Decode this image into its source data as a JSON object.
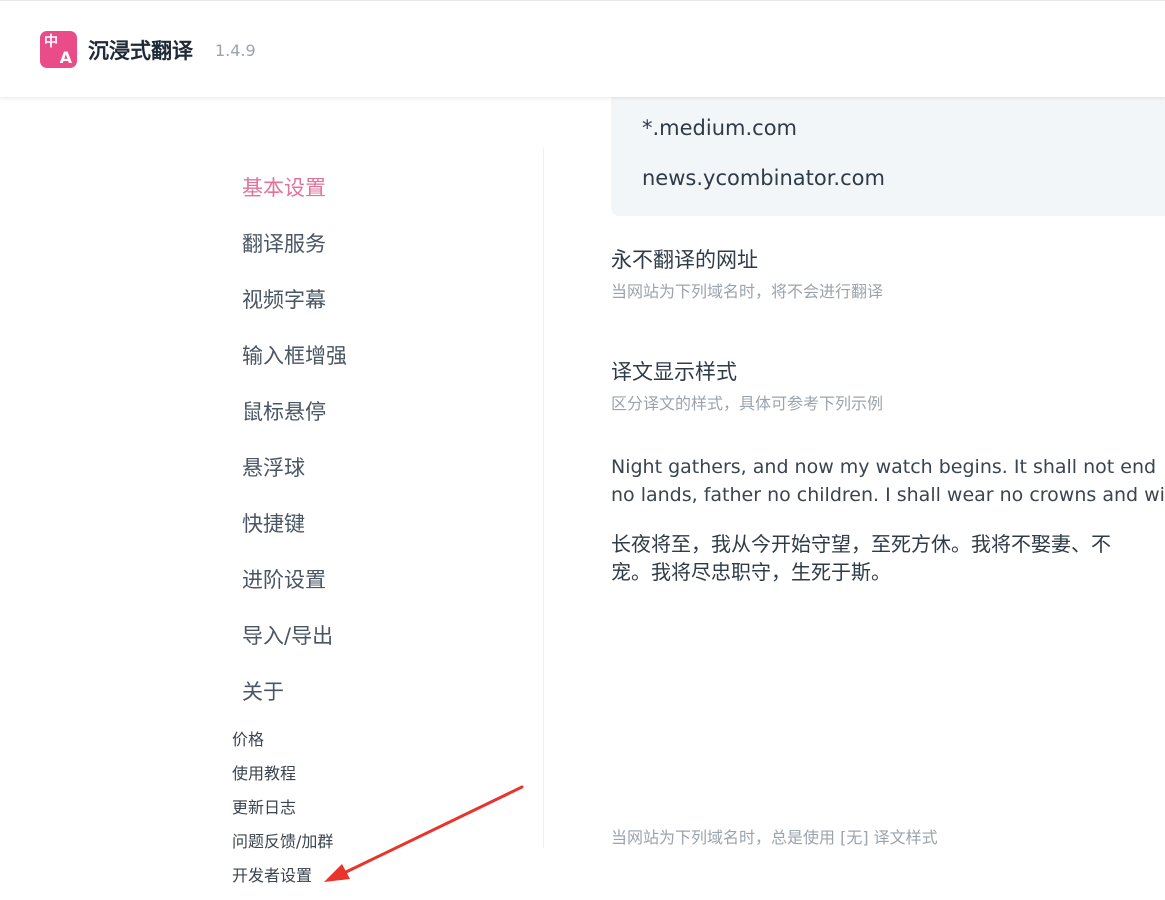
{
  "app": {
    "title": "沉浸式翻译",
    "version": "1.4.9",
    "logo_text_top": "中",
    "logo_text_bottom": "A"
  },
  "sidebar": {
    "items": [
      {
        "label": "基本设置"
      },
      {
        "label": "翻译服务"
      },
      {
        "label": "视频字幕"
      },
      {
        "label": "输入框增强"
      },
      {
        "label": "鼠标悬停"
      },
      {
        "label": "悬浮球"
      },
      {
        "label": "快捷键"
      },
      {
        "label": "进阶设置"
      },
      {
        "label": "导入/导出"
      },
      {
        "label": "关于"
      }
    ],
    "sub_items": [
      {
        "label": "价格"
      },
      {
        "label": "使用教程"
      },
      {
        "label": "更新日志"
      },
      {
        "label": "问题反馈/加群"
      },
      {
        "label": "开发者设置"
      }
    ]
  },
  "main": {
    "domains": [
      "*.medium.com",
      "news.ycombinator.com"
    ],
    "never_translate": {
      "title": "永不翻译的网址",
      "desc": "当网站为下列域名时，将不会进行翻译"
    },
    "display_style": {
      "title": "译文显示样式",
      "desc": "区分译文的样式，具体可参考下列示例"
    },
    "sample_en_line1": "Night gathers, and now my watch begins. It shall not end",
    "sample_en_line2": "no lands, father no children. I shall wear no crowns and win",
    "sample_zh_line1": "长夜将至，我从今开始守望，至死方休。我将不娶妻、不",
    "sample_zh_line2": "宠。我将尽忠职守，生死于斯。",
    "bottom_desc": "当网站为下列域名时，总是使用 [无] 译文样式"
  },
  "colors": {
    "accent": "#e2739c",
    "logo": "#ea4c89",
    "annotation_arrow": "#e8342b"
  }
}
